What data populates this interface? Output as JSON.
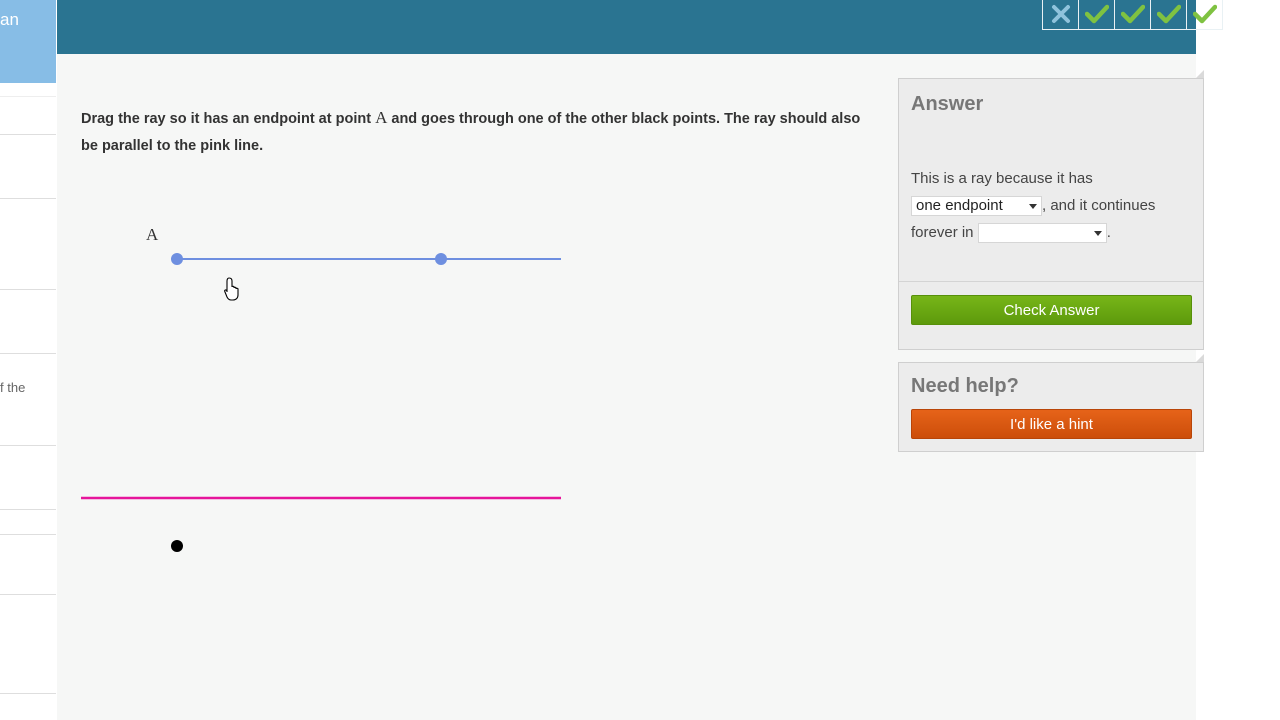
{
  "sidebar": {
    "header_text": "an",
    "snippet": "f the"
  },
  "topbar": {
    "streak": [
      {
        "status": "wrong",
        "icon": "x-icon",
        "color": "#8fc3dc"
      },
      {
        "status": "correct",
        "icon": "check-icon",
        "color": "#7fc241"
      },
      {
        "status": "correct",
        "icon": "check-icon",
        "color": "#7fc241"
      },
      {
        "status": "correct",
        "icon": "check-icon",
        "color": "#7fc241"
      },
      {
        "status": "correct",
        "icon": "check-icon",
        "color": "#7fc241"
      }
    ]
  },
  "question": {
    "part1": "Drag the ray so it has an endpoint at point",
    "point_var": "A",
    "part2": "and goes through one of the other black points. The ray should also be parallel to the pink line."
  },
  "graph": {
    "point_label": "A",
    "ray_color": "#6e8fe0",
    "line_color": "#e6169b",
    "black_point_color": "#000000",
    "cursor": "hand-pointer-icon"
  },
  "answer": {
    "title": "Answer",
    "text1": "This is a ray because it has",
    "select1_value": "one endpoint",
    "text2": ", and it continues forever in",
    "select2_value": "",
    "text3": ".",
    "check_button": "Check Answer",
    "check_color": "#6aa814"
  },
  "help": {
    "title": "Need help?",
    "hint_button": "I'd like a hint",
    "hint_color": "#d95812"
  }
}
